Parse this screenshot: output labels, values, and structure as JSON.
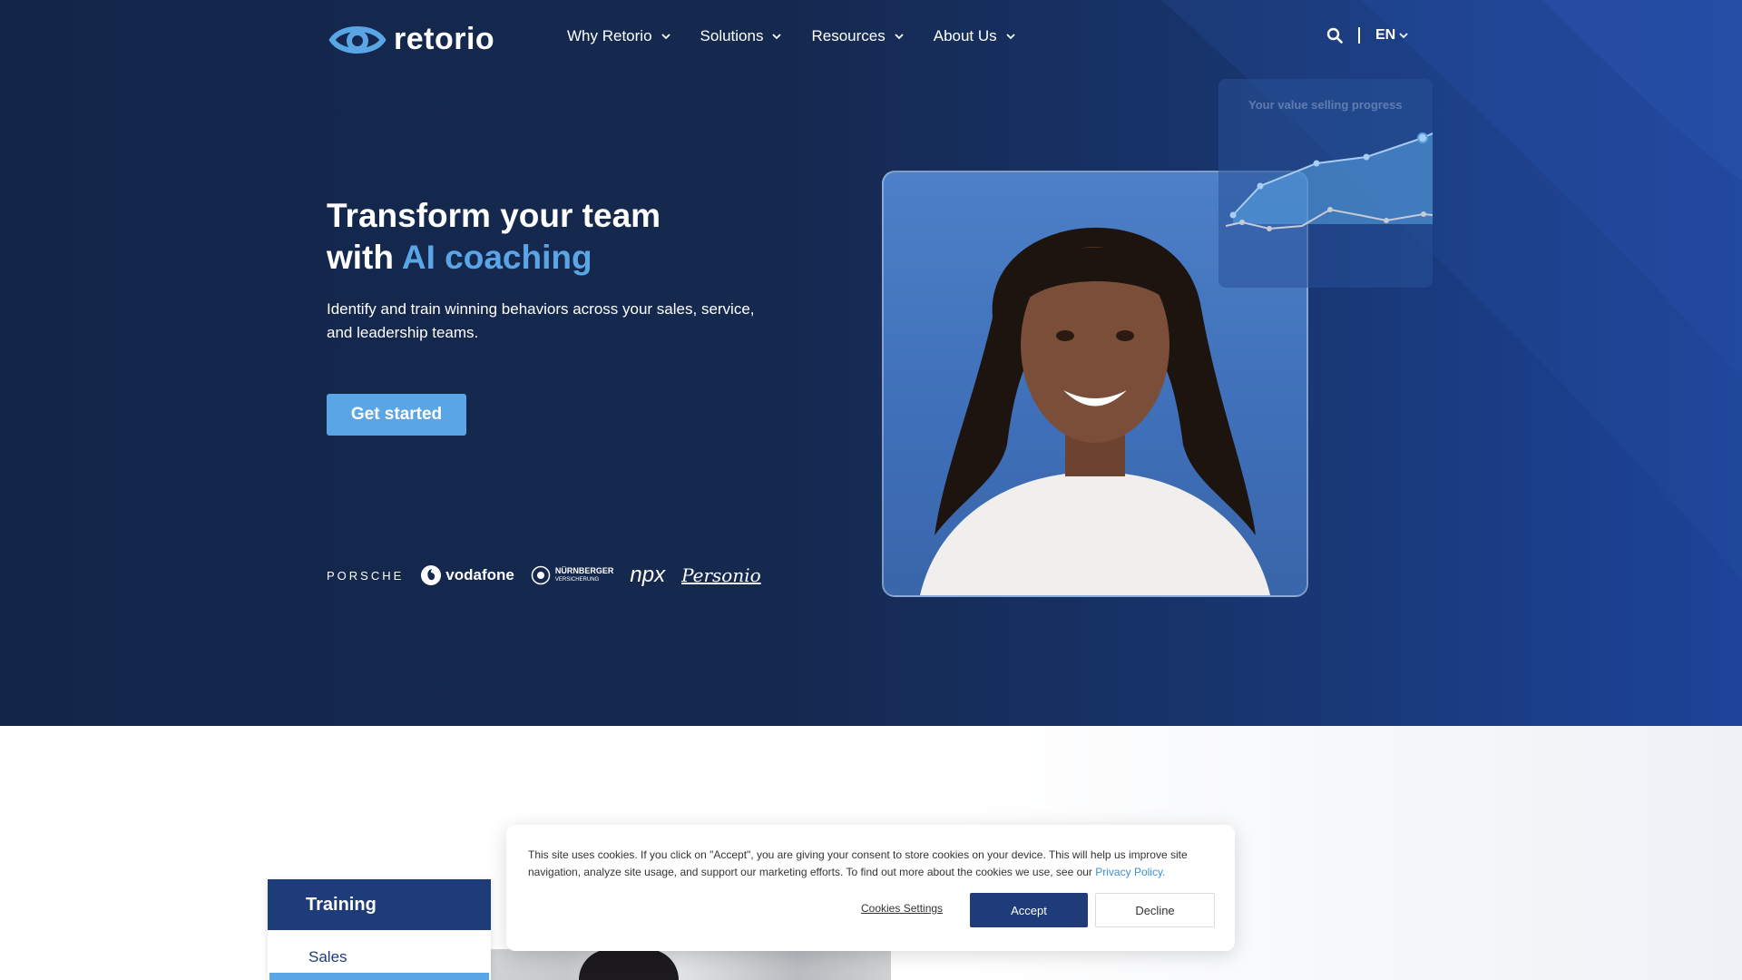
{
  "brand": {
    "name": "retorio",
    "logo_icon": "eye-logo-icon"
  },
  "nav": {
    "items": [
      {
        "label": "Why Retorio"
      },
      {
        "label": "Solutions"
      },
      {
        "label": "Resources"
      },
      {
        "label": "About Us"
      }
    ],
    "search_icon": "search-icon",
    "language": "EN"
  },
  "hero": {
    "headline_line1": "Transform your team",
    "headline_with": "with ",
    "headline_accent": "AI coaching",
    "subtext": "Identify and train winning behaviors across your sales, service, and leadership teams.",
    "cta_label": "Get started",
    "client_logos": {
      "porsche": "PORSCHE",
      "vodafone": "vodafone",
      "nurnberger": "NÜRNBERGER",
      "nurnberger_sub": "VERSICHERUNG",
      "npx": "npx",
      "personio": "Personio"
    },
    "chart_card_title": "Your value selling progress"
  },
  "training": {
    "title": "Training",
    "item": "Sales"
  },
  "cookie_banner": {
    "text": "This site uses cookies. If you click on \"Accept\", you are giving your consent to store cookies on your device. This will help us improve site navigation, analyze site usage, and support our marketing efforts. To find out more about the cookies we use, see our ",
    "link_text": "Privacy Policy.",
    "settings_label": "Cookies Settings",
    "accept_label": "Accept",
    "decline_label": "Decline"
  },
  "colors": {
    "hero_bg": "#14254a",
    "accent": "#5aa5e6",
    "navy": "#1e3b7a"
  }
}
